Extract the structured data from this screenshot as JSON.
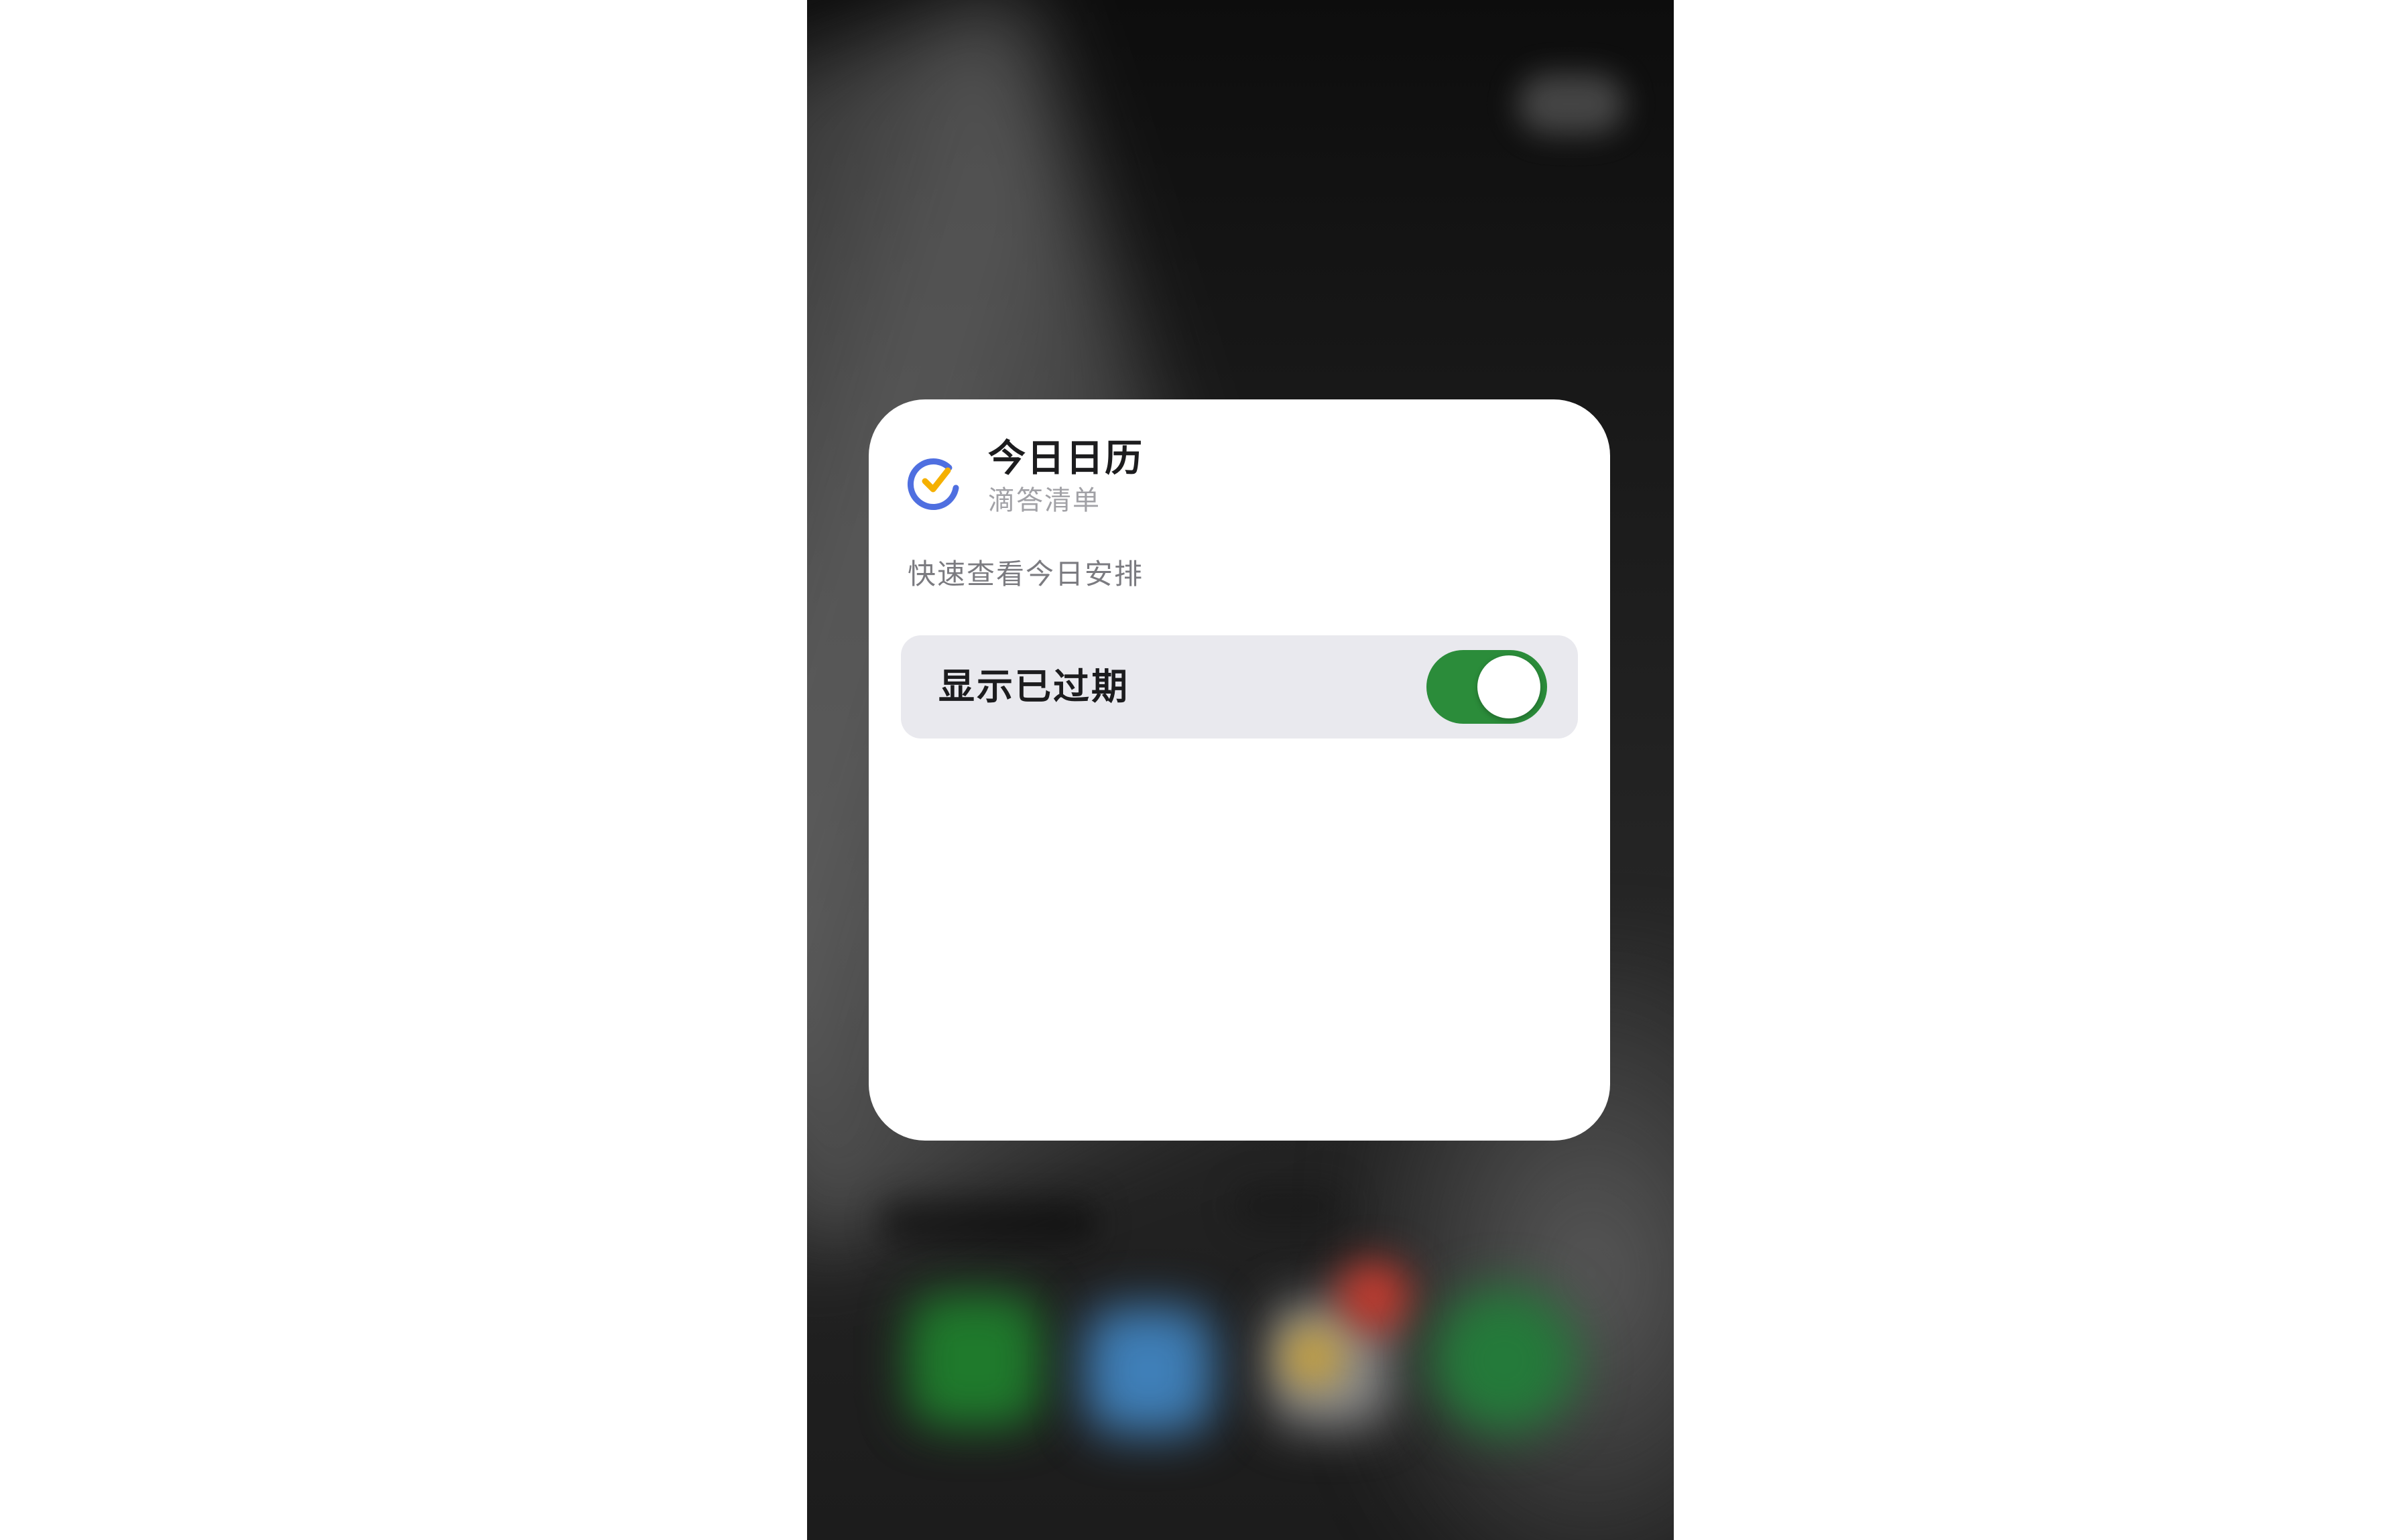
{
  "widget": {
    "title": "今日日历",
    "app_name": "滴答清单",
    "description": "快速查看今日安排",
    "app_icon": "dida-check-icon",
    "option": {
      "label": "显示已过期",
      "toggle_on": true,
      "toggle_color": "#2B8C3A"
    }
  },
  "colors": {
    "card_background": "#FFFFFF",
    "option_row_background": "#E9E9EE",
    "icon_ring_blue": "#4F6FE0",
    "icon_check_yellow": "#F5B000"
  }
}
